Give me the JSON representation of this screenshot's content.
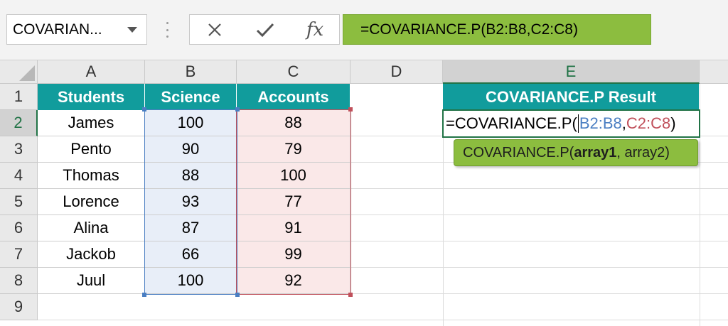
{
  "formula_bar": {
    "name_box": "COVARIAN...",
    "cancel_icon": "close-icon",
    "enter_icon": "checkmark-icon",
    "fx_label": "fx",
    "formula": "=COVARIANCE.P(B2:B8,C2:C8)"
  },
  "columns": [
    "A",
    "B",
    "C",
    "D",
    "E"
  ],
  "rows": [
    "1",
    "2",
    "3",
    "4",
    "5",
    "6",
    "7",
    "8",
    "9"
  ],
  "table": {
    "headers": [
      "Students",
      "Science",
      "Accounts"
    ],
    "students": [
      "James",
      "Pento",
      "Thomas",
      "Lorence",
      "Alina",
      "Jackob",
      "Juul"
    ],
    "science": [
      "100",
      "90",
      "88",
      "93",
      "87",
      "66",
      "100"
    ],
    "accounts": [
      "88",
      "79",
      "100",
      "77",
      "91",
      "99",
      "92"
    ]
  },
  "result": {
    "header": "COVARIANCE.P Result",
    "edit_prefix": "=COVARIANCE.P(",
    "edit_ref1": "B2:B8",
    "edit_sep": ",",
    "edit_ref2": "C2:C8",
    "edit_suffix": ")"
  },
  "tooltip": {
    "func": "COVARIANCE.P(",
    "arg1": "array1",
    "rest": ", array2)"
  },
  "colors": {
    "header_teal": "#119c9c",
    "formula_green": "#8cbd3f",
    "excel_green": "#217346",
    "range_blue": "#4a7ec2",
    "range_red": "#c0505b"
  }
}
